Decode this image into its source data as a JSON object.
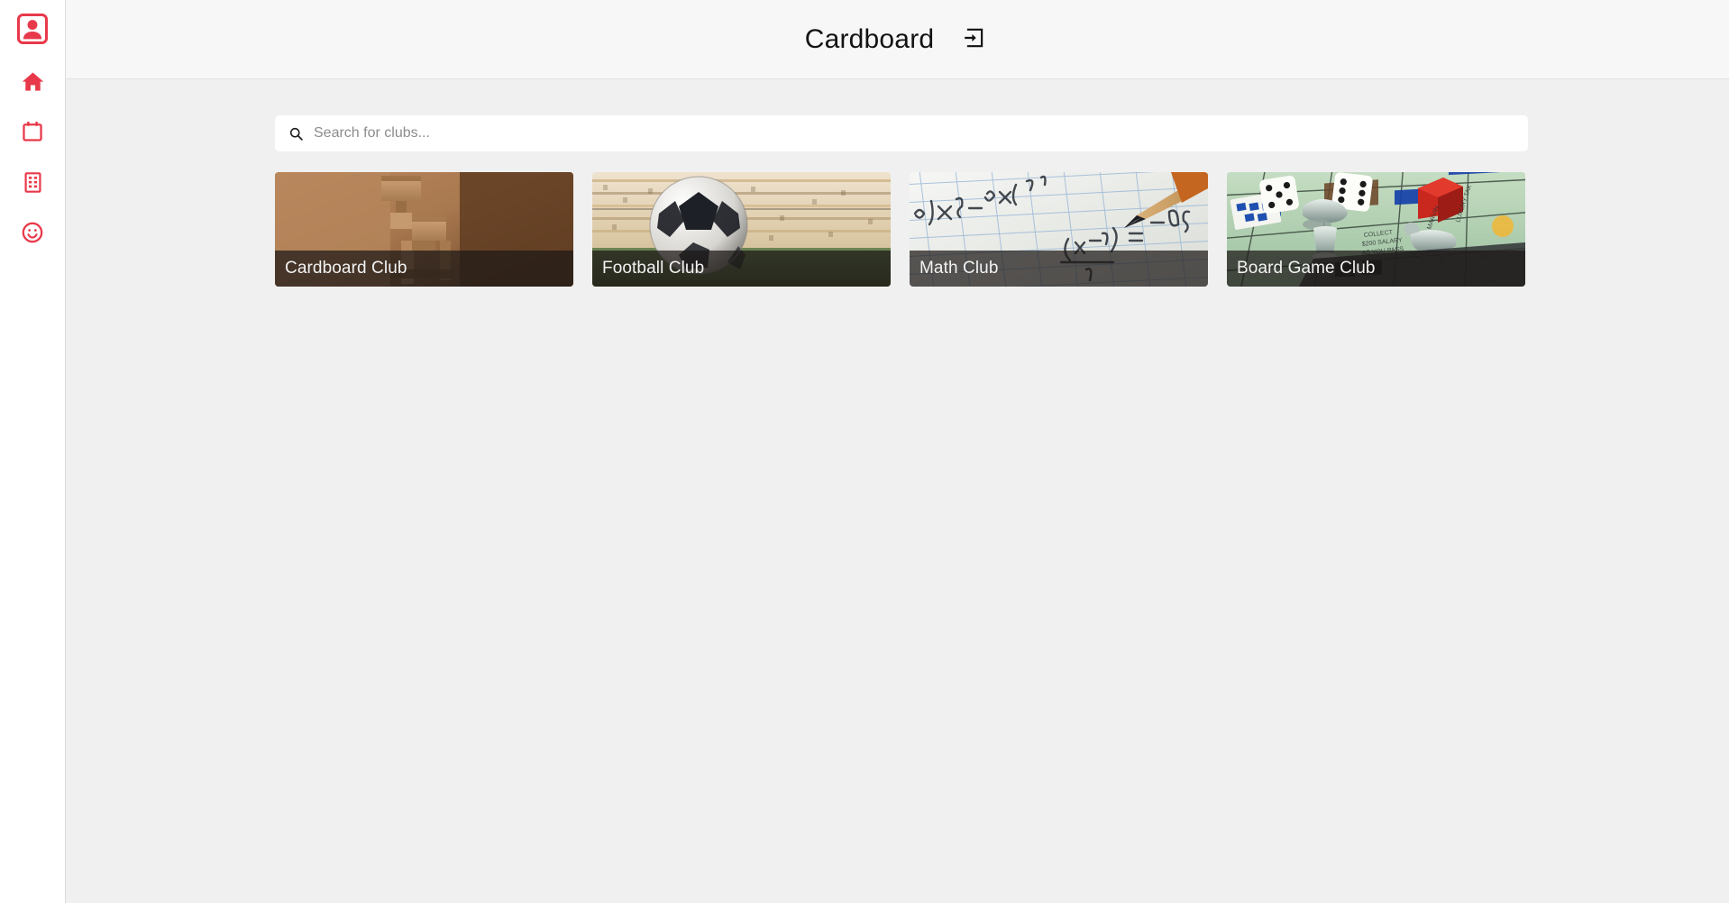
{
  "header": {
    "title": "Cardboard",
    "login_icon": "login-icon"
  },
  "sidebar": {
    "items": [
      {
        "name": "account-box-icon",
        "label": "Account"
      },
      {
        "name": "home-icon",
        "label": "Home"
      },
      {
        "name": "calendar-icon",
        "label": "Calendar"
      },
      {
        "name": "building-icon",
        "label": "Clubs"
      },
      {
        "name": "smiley-icon",
        "label": "Profile"
      }
    ],
    "accent_color": "#e8394a"
  },
  "search": {
    "icon": "search-icon",
    "value": "",
    "placeholder": "Search for clubs..."
  },
  "clubs": [
    {
      "name": "Cardboard Club",
      "image": "cardboard-robot-photo"
    },
    {
      "name": "Football Club",
      "image": "soccer-ball-stadium-photo"
    },
    {
      "name": "Math Club",
      "image": "math-equations-pencil-photo"
    },
    {
      "name": "Board Game Club",
      "image": "monopoly-board-photo"
    }
  ],
  "colors": {
    "accent": "#e8394a",
    "header_bg": "#f7f7f7",
    "page_bg": "#f0f0f0",
    "sidebar_bg": "#ffffff",
    "card_label_bg": "rgba(28,24,22,0.72)"
  }
}
